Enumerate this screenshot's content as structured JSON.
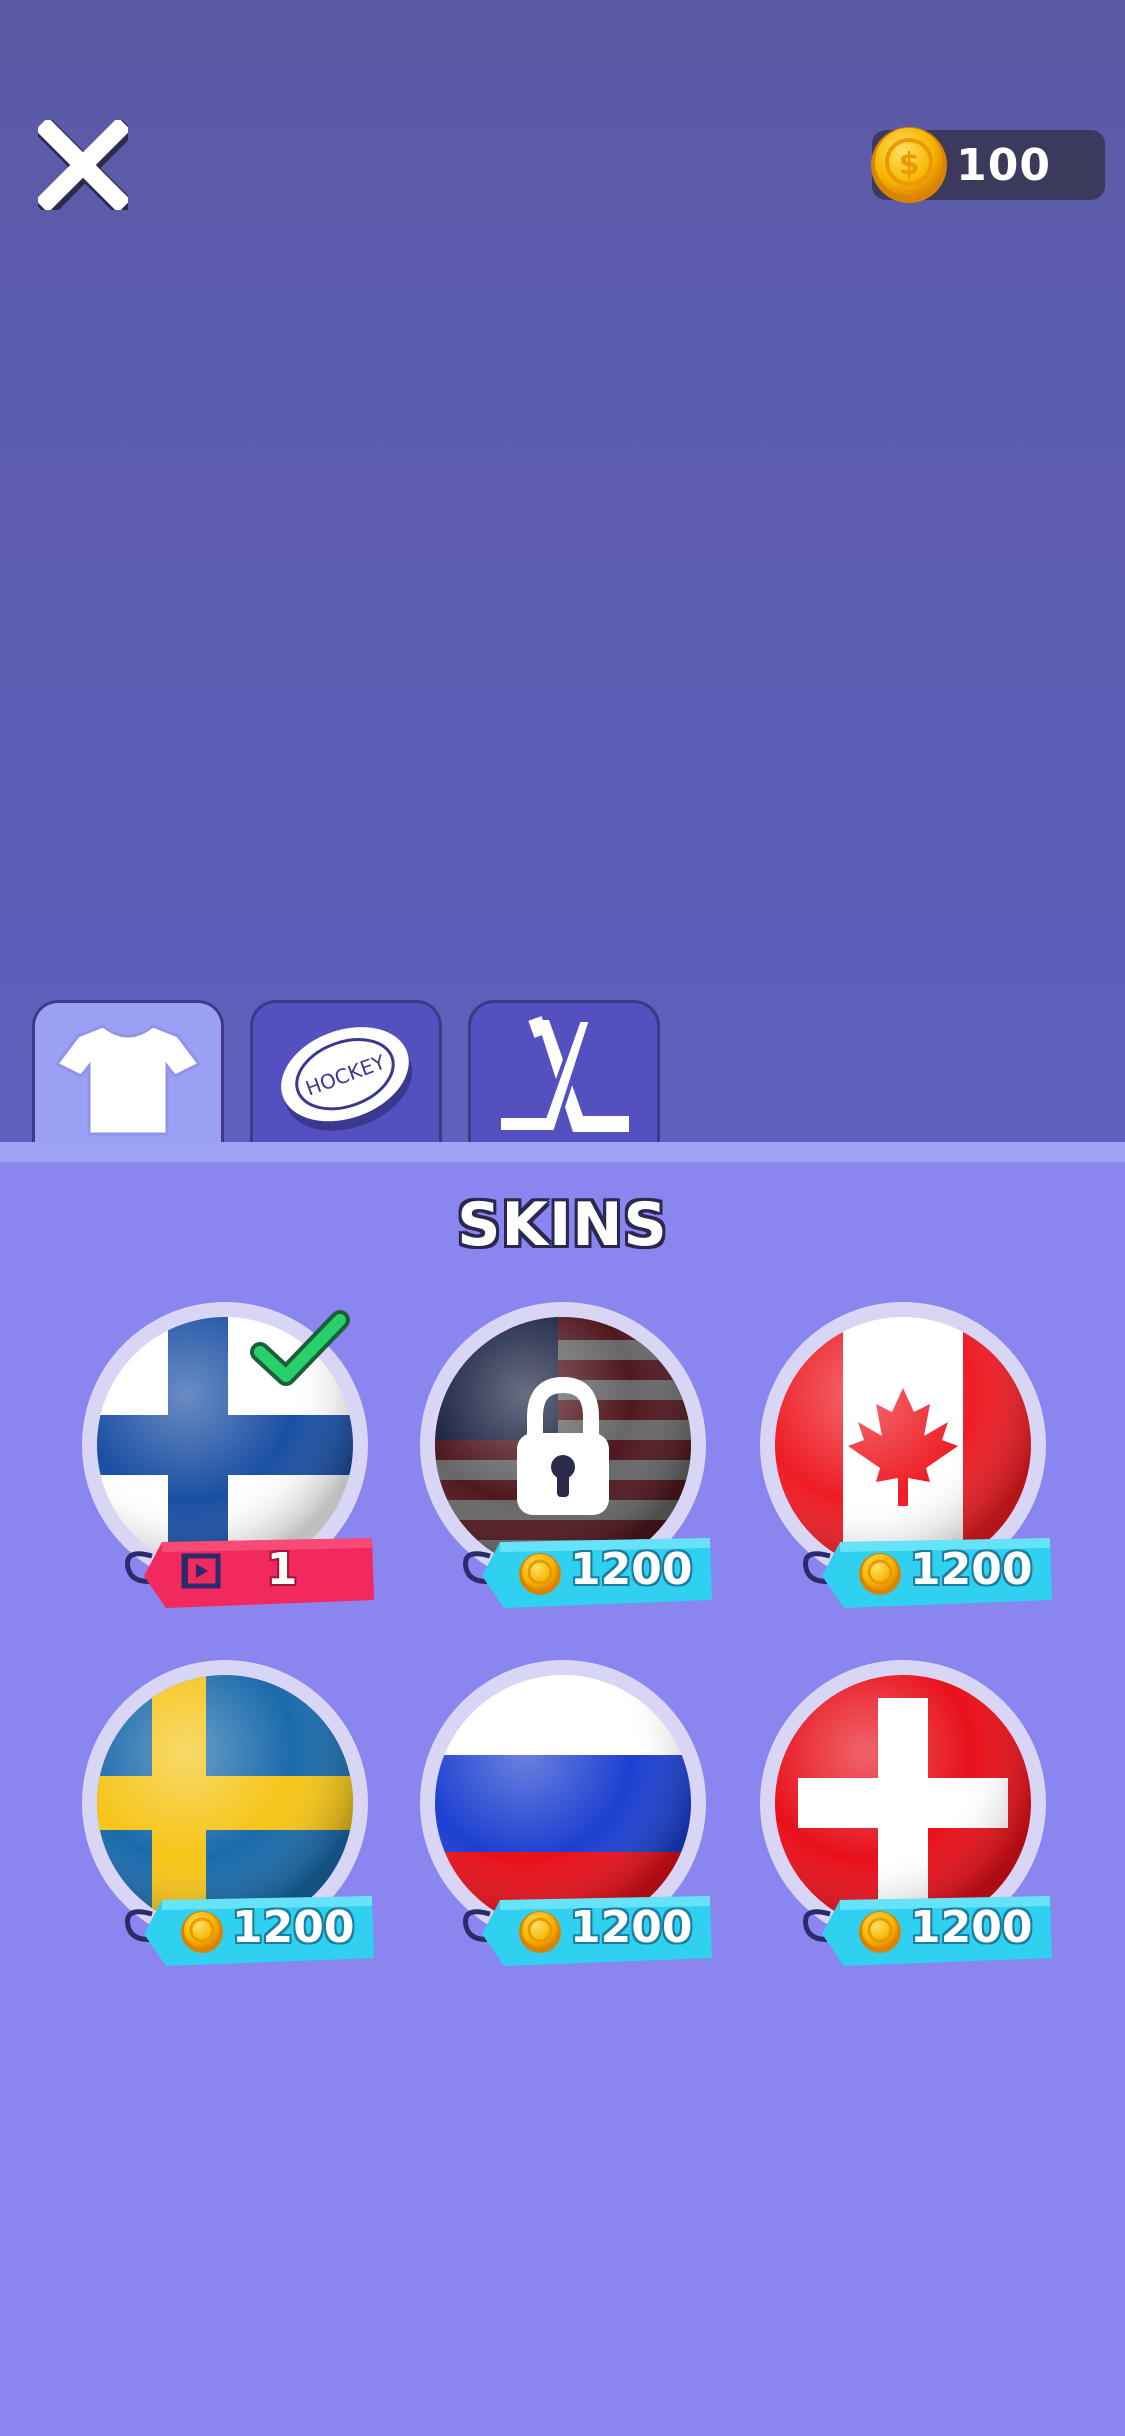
{
  "header": {
    "coins": "100",
    "close_icon": "close-x-icon",
    "coin_icon": "gold-coin-icon"
  },
  "tabs": [
    {
      "name": "jersey",
      "icon": "tshirt-icon",
      "active": true
    },
    {
      "name": "puck",
      "icon": "hockey-puck-icon",
      "puck_text": "HOCKEY",
      "active": false
    },
    {
      "name": "sticks",
      "icon": "crossed-sticks-icon",
      "active": false
    }
  ],
  "section_title": "SKINS",
  "skins": [
    {
      "flag": "Finland",
      "price": "1",
      "currency": "video-ad",
      "selected": true,
      "locked": false
    },
    {
      "flag": "USA",
      "price": "1200",
      "currency": "coins",
      "selected": false,
      "locked": true
    },
    {
      "flag": "Canada",
      "price": "1200",
      "currency": "coins",
      "selected": false,
      "locked": false
    },
    {
      "flag": "Sweden",
      "price": "1200",
      "currency": "coins",
      "selected": false,
      "locked": false
    },
    {
      "flag": "Russia",
      "price": "1200",
      "currency": "coins",
      "selected": false,
      "locked": false
    },
    {
      "flag": "Switzerland",
      "price": "1200",
      "currency": "coins",
      "selected": false,
      "locked": false
    }
  ],
  "colors": {
    "panel": "#8a85ef",
    "tab_active": "#9aa0f4",
    "tag_coin": "#2fd0f0",
    "tag_video": "#f2295e",
    "check": "#22c55e"
  }
}
